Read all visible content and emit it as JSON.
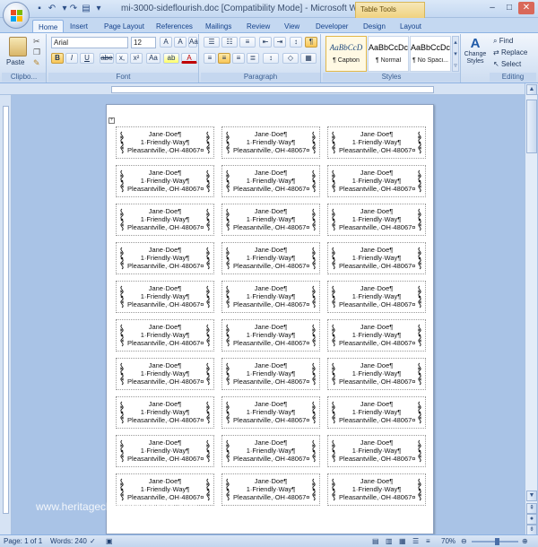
{
  "window": {
    "title": "mi-3000-sideflourish.doc [Compatibility Mode] - Microsoft Word",
    "context_tab": "Table Tools"
  },
  "tabs": [
    "Home",
    "Insert",
    "Page Layout",
    "References",
    "Mailings",
    "Review",
    "View",
    "Developer",
    "Design",
    "Layout"
  ],
  "ribbon": {
    "clipboard": {
      "paste_label": "Paste",
      "group_label": "Clipbo..."
    },
    "font": {
      "name": "Arial",
      "size": "12",
      "group_label": "Font",
      "bold": "B",
      "italic": "I",
      "underline": "U",
      "strike": "abe",
      "subscript": "x,",
      "superscript": "x²",
      "clear": "Aa",
      "highlight": "ab",
      "color": "A"
    },
    "paragraph": {
      "group_label": "Paragraph",
      "pilcrow": "¶"
    },
    "styles": {
      "group_label": "Styles",
      "items": [
        {
          "sample": "AaBbCcD",
          "name": "¶ Caption"
        },
        {
          "sample": "AaBbCcDc",
          "name": "¶ Normal"
        },
        {
          "sample": "AaBbCcDc",
          "name": "¶ No Spaci..."
        }
      ],
      "change_styles": "Change Styles"
    },
    "editing": {
      "group_label": "Editing",
      "find": "Find",
      "replace": "Replace",
      "select": "Select"
    }
  },
  "label": {
    "name": "Jane·Doe¶",
    "street": "1·Friendly·Way¶",
    "city": "Pleasantville,·OH·48067¤"
  },
  "watermark": "www.heritagechristiancollege.com",
  "status": {
    "page": "Page: 1 of 1",
    "words": "Words: 240",
    "zoom": "70%"
  },
  "colors": {
    "accent": "#15428b",
    "ribbon_bg": "#dbe7f6",
    "workspace": "#a9c3e6"
  }
}
